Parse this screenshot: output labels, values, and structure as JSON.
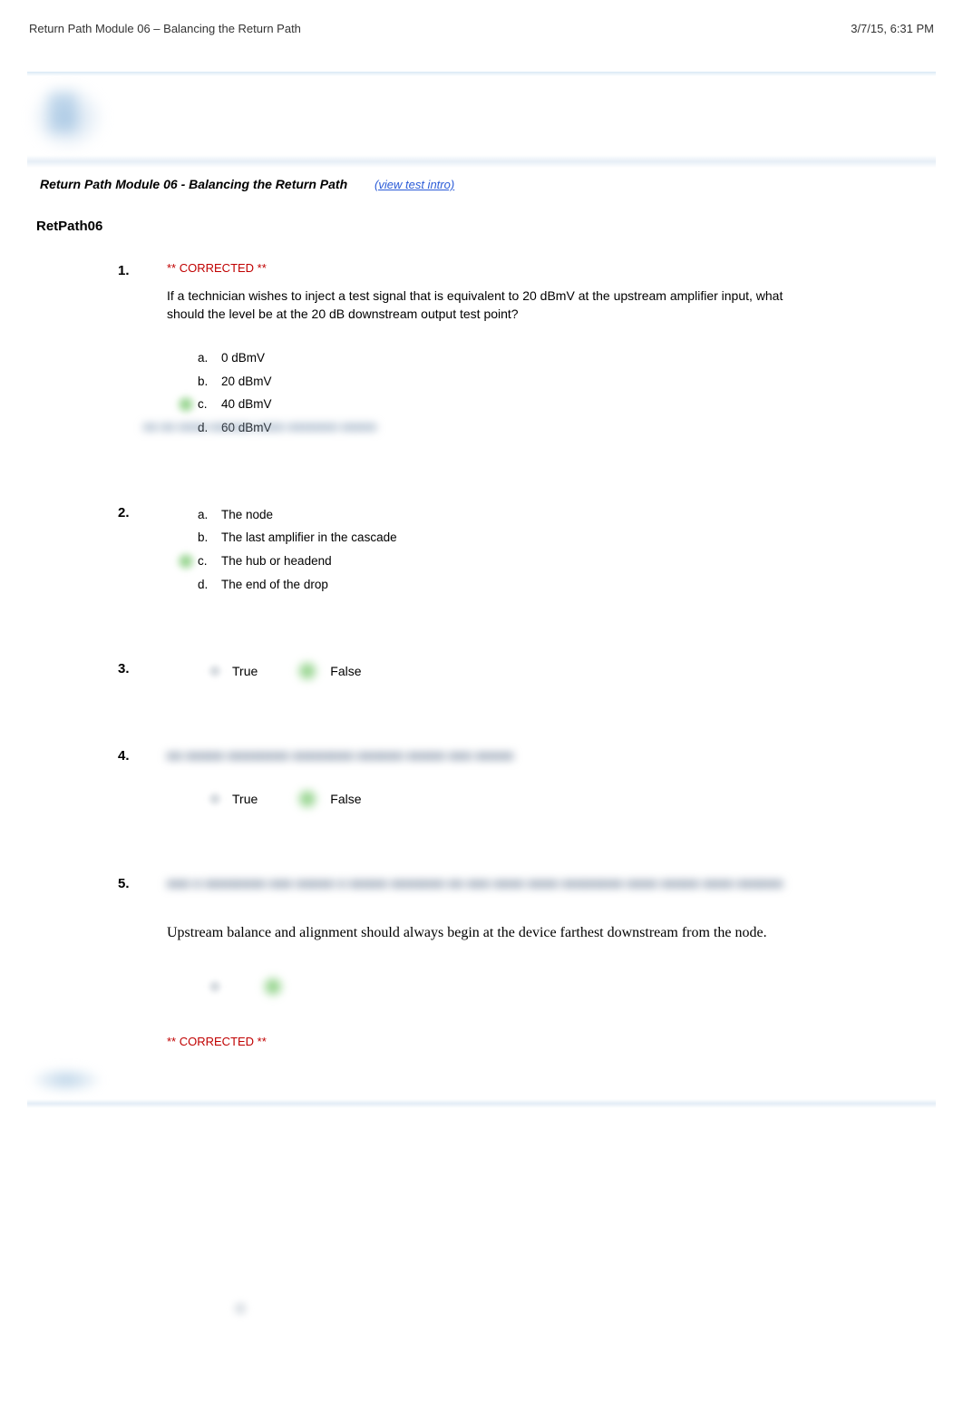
{
  "header": {
    "left": "Return Path Module 06 – Balancing the Return Path",
    "right": "3/7/15, 6:31 PM"
  },
  "title_bar": {
    "module": "Return Path Module 06 - Balancing the Return Path",
    "view_intro": "(view test intro)"
  },
  "section": "RetPath06",
  "corrected_label": "** CORRECTED **",
  "blur_placeholder_a": "■■ ■■ ■■■■ ■■■■■■ ■■■■ ■■■■■■■ ■■■■■",
  "blur_placeholder_b": "■■ ■■■■■ ■■■■■■■■ ■■■■■■■■ ■■■■■■ ■■■■■ ■■■ ■■■■■",
  "blur_placeholder_c": "■■■ ■ ■■■■■■■■ ■■■ ■■■■■ ■ ■■■■■ ■■■■■■■ ■■ ■■■ ■■■■ ■■■■ ■■■■■■■■ ■■■■ ■■■■■ ■■■■ ■■■■■■",
  "tf": {
    "true": "True",
    "false": "False"
  },
  "questions": [
    {
      "num": "1.",
      "corrected": true,
      "prompt": "If a technician wishes to inject a test signal that is equivalent to 20 dBmV at the upstream amplifier input, what should the level be at the 20 dB downstream output test point?",
      "choices": [
        {
          "letter": "a.",
          "text": "0 dBmV"
        },
        {
          "letter": "b.",
          "text": "20 dBmV"
        },
        {
          "letter": "c.",
          "text": "40 dBmV",
          "marked": true
        },
        {
          "letter": "d.",
          "text": "60 dBmV",
          "blurstrip": true
        }
      ]
    },
    {
      "num": "2.",
      "choices": [
        {
          "letter": "a.",
          "text": "The node"
        },
        {
          "letter": "b.",
          "text": "The last amplifier in the cascade"
        },
        {
          "letter": "c.",
          "text": "The hub or headend",
          "marked": true
        },
        {
          "letter": "d.",
          "text": "The end of the drop"
        }
      ]
    },
    {
      "num": "3.",
      "tf": true,
      "tf_marked": "false"
    },
    {
      "num": "4.",
      "blurred_prompt": true,
      "tf": true,
      "tf_marked": "false"
    },
    {
      "num": "5.",
      "blurred_prompt_top": true,
      "prompt_alt": "Upstream balance and alignment should always begin at the device farthest downstream from the node.",
      "tf_blurred": true,
      "corrected_after": true
    }
  ]
}
